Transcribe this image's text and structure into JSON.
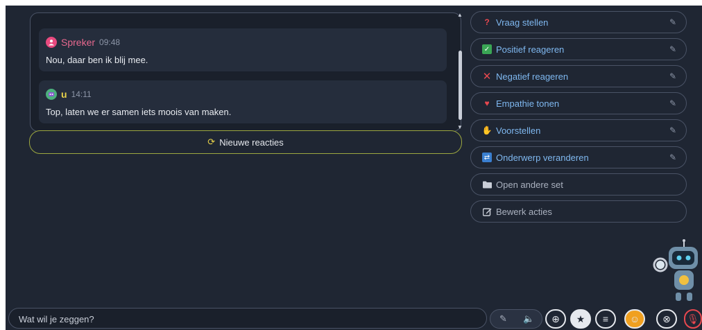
{
  "chat": {
    "messages": [
      {
        "author": "Spreker",
        "time": "09:48",
        "text": "Nou, daar ben ik blij mee."
      },
      {
        "author": "u",
        "time": "14:11",
        "text": "Top, laten we er samen iets moois van maken."
      }
    ]
  },
  "new_reactions_label": "Nieuwe reacties",
  "actions": [
    {
      "label": "Vraag stellen",
      "icon": "question-icon"
    },
    {
      "label": "Positief reageren",
      "icon": "check-icon"
    },
    {
      "label": "Negatief reageren",
      "icon": "cross-icon"
    },
    {
      "label": "Empathie tonen",
      "icon": "heart-icon"
    },
    {
      "label": "Voorstellen",
      "icon": "hand-icon"
    },
    {
      "label": "Onderwerp veranderen",
      "icon": "swap-icon"
    },
    {
      "label": "Open andere set",
      "icon": "folder-icon"
    },
    {
      "label": "Bewerk acties",
      "icon": "edit-icon"
    }
  ],
  "input": {
    "placeholder": "Wat wil je zeggen?"
  },
  "colors": {
    "background": "#1f2633",
    "accent_blue": "#7fb8f0",
    "accent_yellow": "#e8d24a",
    "speaker_pink": "#e8698f"
  }
}
